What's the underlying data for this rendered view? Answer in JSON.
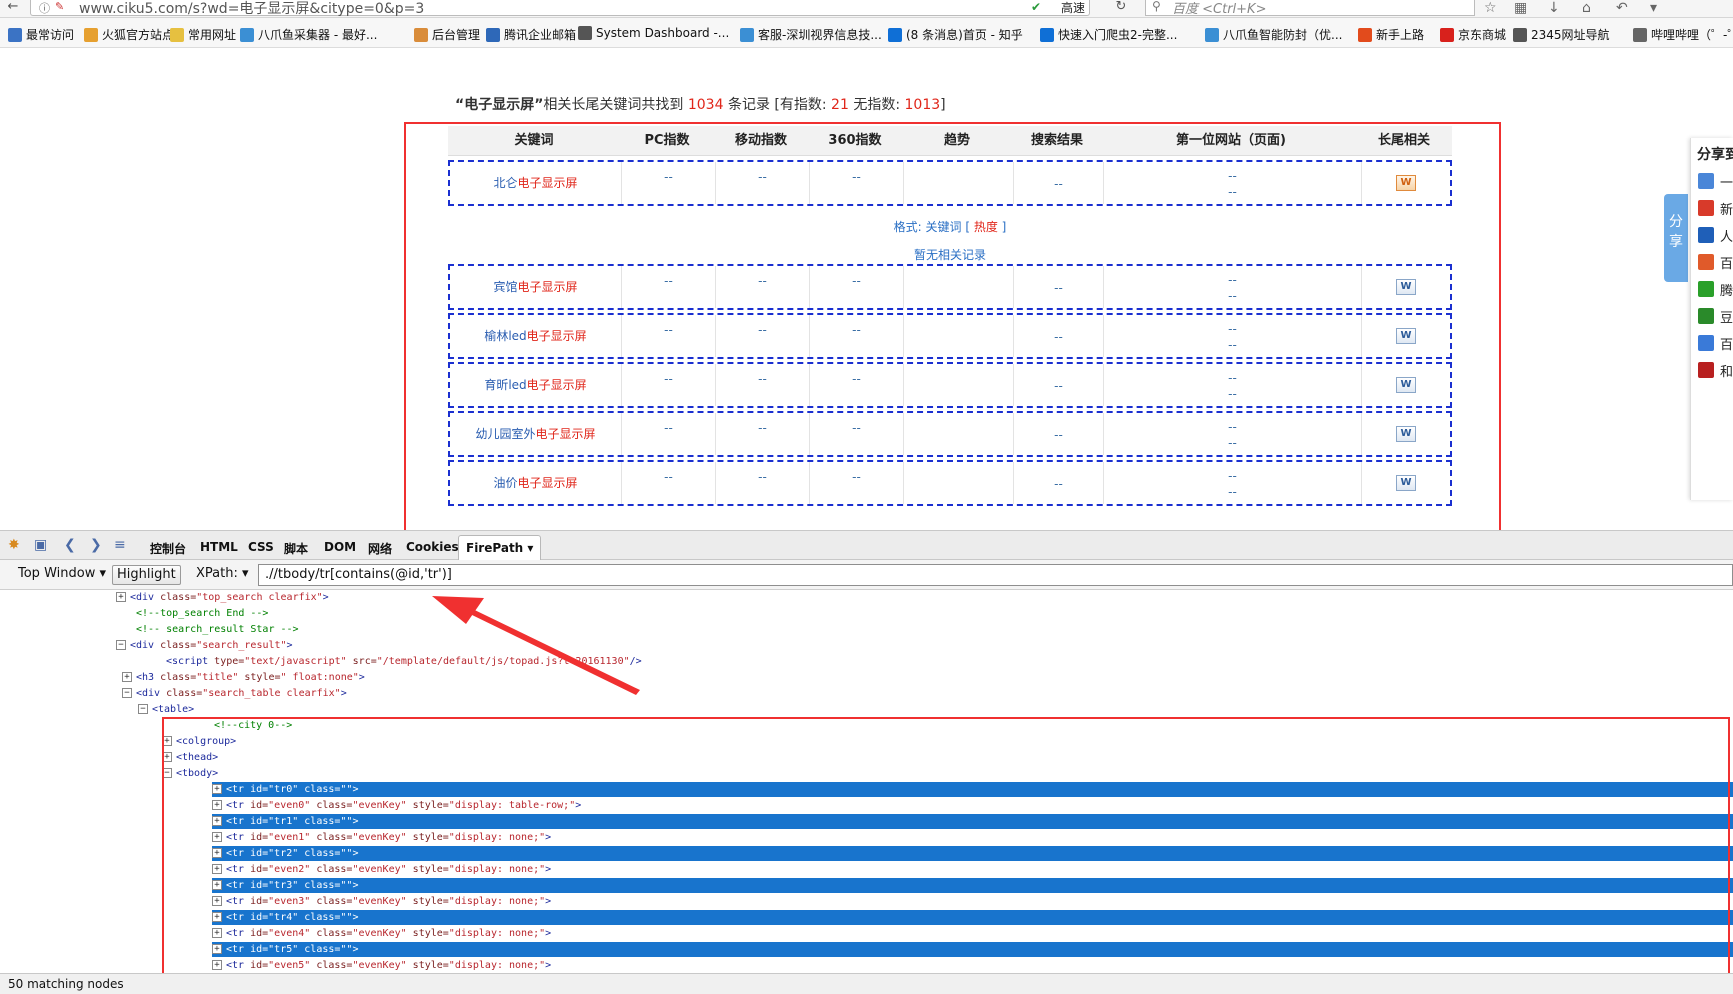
{
  "browser": {
    "url": "www.ciku5.com/s?wd=电子显示屏&citype=0&p=3",
    "search_placeholder": "百度 <Ctrl+K>",
    "speed_label": "高速",
    "bookmarks": [
      {
        "label": "最常访问",
        "icon_color": "#3b73c4"
      },
      {
        "label": "火狐官方站点",
        "icon_color": "#e6a030"
      },
      {
        "label": "常用网址",
        "icon_color": "#e6c040"
      },
      {
        "label": "八爪鱼采集器 - 最好...",
        "icon_color": "#3b8fd4"
      },
      {
        "label": "后台管理",
        "icon_color": "#d98c3a"
      },
      {
        "label": "腾讯企业邮箱",
        "icon_color": "#2e68b8"
      },
      {
        "label": "System Dashboard -...",
        "icon_color": "#555555"
      },
      {
        "label": "客服-深圳视界信息技...",
        "icon_color": "#3b8fd4"
      },
      {
        "label": "(8 条消息)首页 - 知乎",
        "icon_color": "#0f6fd6"
      },
      {
        "label": "快速入门爬虫2-完整...",
        "icon_color": "#0f6fd6"
      },
      {
        "label": "八爪鱼智能防封（优...",
        "icon_color": "#3b8fd4"
      },
      {
        "label": "新手上路",
        "icon_color": "#e24b1c"
      },
      {
        "label": "京东商城",
        "icon_color": "#d8211c"
      },
      {
        "label": "2345网址导航",
        "icon_color": "#555555"
      },
      {
        "label": "哔哩哔哩（゜-゜）",
        "icon_color": "#666666"
      }
    ]
  },
  "summary": {
    "keyword": "“电子显示屏”",
    "text1": "相关长尾关键词共找到",
    "total": "1034",
    "text2": "条记录 [有指数:",
    "with_index": "21",
    "text3": "无指数:",
    "no_index": "1013",
    "text4": "]"
  },
  "table": {
    "headers": [
      "关键词",
      "PC指数",
      "移动指数",
      "360指数",
      "趋势",
      "搜索结果",
      "第一位网站（页面)",
      "长尾相关"
    ],
    "first_row": {
      "prefix": "北仑",
      "highlight": "电子显示屏",
      "pc": "--",
      "mobile": "--",
      "s360": "--",
      "trend": "",
      "results": "--",
      "site1": "--",
      "site2": "--",
      "icon": "W"
    },
    "format_label": "格式:",
    "format_kw": "关键词",
    "format_hot": "热度",
    "no_related": "暂无相关记录",
    "rows": [
      {
        "prefix": "宾馆",
        "highlight": "电子显示屏",
        "pc": "--",
        "mobile": "--",
        "s360": "--",
        "results": "--",
        "site1": "--",
        "site2": "--",
        "icon": "W"
      },
      {
        "prefix": "榆林led",
        "highlight": "电子显示屏",
        "pc": "--",
        "mobile": "--",
        "s360": "--",
        "results": "--",
        "site1": "--",
        "site2": "--",
        "icon": "W"
      },
      {
        "prefix": "育昕led",
        "highlight": "电子显示屏",
        "pc": "--",
        "mobile": "--",
        "s360": "--",
        "results": "--",
        "site1": "--",
        "site2": "--",
        "icon": "W"
      },
      {
        "prefix": "幼儿园室外",
        "highlight": "电子显示屏",
        "pc": "--",
        "mobile": "--",
        "s360": "--",
        "results": "--",
        "site1": "--",
        "site2": "--",
        "icon": "W"
      },
      {
        "prefix": "油价",
        "highlight": "电子显示屏",
        "pc": "--",
        "mobile": "--",
        "s360": "--",
        "results": "--",
        "site1": "--",
        "site2": "--",
        "icon": "W"
      }
    ]
  },
  "share": {
    "tab_label": "分享",
    "title": "分享到",
    "items": [
      {
        "label": "一",
        "color": "#4a86d8"
      },
      {
        "label": "新",
        "color": "#d83a2a"
      },
      {
        "label": "人",
        "color": "#1f5fb8"
      },
      {
        "label": "百",
        "color": "#e05a2a"
      },
      {
        "label": "腾",
        "color": "#2aa02a"
      },
      {
        "label": "豆",
        "color": "#2a8a2a"
      },
      {
        "label": "百",
        "color": "#3a7ad8"
      },
      {
        "label": "和",
        "color": "#b82020"
      }
    ]
  },
  "devtools": {
    "tabs": [
      "控制台",
      "HTML",
      "CSS",
      "脚本",
      "DOM",
      "网络",
      "Cookies",
      "FirePath"
    ],
    "active_tab": "FirePath",
    "top_window": "Top Window",
    "highlight": "Highlight",
    "xpath_label": "XPath:",
    "xpath_value": ".//tbody/tr[contains(@id,'tr')]",
    "status": "50 matching nodes"
  },
  "html_tree": [
    {
      "indent": 0,
      "exp": "+",
      "parts": [
        [
          "tag",
          "<div "
        ],
        [
          "attr",
          "class="
        ],
        [
          "val",
          "\"top_search clearfix\""
        ],
        [
          "tag",
          ">"
        ]
      ]
    },
    {
      "indent": 1,
      "exp": "",
      "parts": [
        [
          "comment",
          "<!--top_search End -->"
        ]
      ]
    },
    {
      "indent": 1,
      "exp": "",
      "parts": [
        [
          "comment",
          "<!-- search_result Star -->"
        ]
      ]
    },
    {
      "indent": 0,
      "exp": "-",
      "parts": [
        [
          "tag",
          "<div "
        ],
        [
          "attr",
          "class="
        ],
        [
          "val",
          "\"search_result\""
        ],
        [
          "tag",
          ">"
        ]
      ]
    },
    {
      "indent": 2,
      "exp": "",
      "parts": [
        [
          "tag",
          "<script "
        ],
        [
          "attr",
          "type="
        ],
        [
          "val",
          "\"text/javascript\" "
        ],
        [
          "attr",
          "src="
        ],
        [
          "val",
          "\"/template/default/js/topad.js?t=20161130\""
        ],
        [
          "tag",
          "/>"
        ]
      ]
    },
    {
      "indent": 1,
      "exp": "+",
      "parts": [
        [
          "tag",
          "<h3 "
        ],
        [
          "attr",
          "class="
        ],
        [
          "val",
          "\"title\" "
        ],
        [
          "attr",
          "style="
        ],
        [
          "val",
          "\" float:none\""
        ],
        [
          "tag",
          ">"
        ]
      ]
    },
    {
      "indent": 1,
      "exp": "-",
      "parts": [
        [
          "tag",
          "<div "
        ],
        [
          "attr",
          "class="
        ],
        [
          "val",
          "\"search_table clearfix\""
        ],
        [
          "tag",
          ">"
        ]
      ]
    },
    {
      "indent": 2,
      "exp": "-",
      "parts": [
        [
          "tag",
          "<table>"
        ]
      ]
    },
    {
      "indent": 3,
      "exp": "",
      "parts": [
        [
          "comment",
          "<!--city 0-->"
        ]
      ]
    },
    {
      "indent": 3,
      "exp": "+",
      "parts": [
        [
          "tag",
          "<colgroup>"
        ]
      ]
    },
    {
      "indent": 3,
      "exp": "+",
      "parts": [
        [
          "tag",
          "<thead>"
        ]
      ]
    },
    {
      "indent": 3,
      "exp": "-",
      "parts": [
        [
          "tag",
          "<tbody>"
        ]
      ]
    },
    {
      "indent": 4,
      "exp": "+",
      "sel": true,
      "parts": [
        [
          "tag",
          "<tr "
        ],
        [
          "attr",
          "id="
        ],
        [
          "val",
          "\"tr0\" "
        ],
        [
          "attr",
          "class="
        ],
        [
          "val",
          "\"\""
        ],
        [
          "tag",
          ">"
        ]
      ]
    },
    {
      "indent": 4,
      "exp": "+",
      "parts": [
        [
          "tag",
          "<tr "
        ],
        [
          "attr",
          "id="
        ],
        [
          "val",
          "\"even0\" "
        ],
        [
          "attr",
          "class="
        ],
        [
          "val",
          "\"evenKey\" "
        ],
        [
          "attr",
          "style="
        ],
        [
          "val",
          "\"display: table-row;\""
        ],
        [
          "tag",
          ">"
        ]
      ]
    },
    {
      "indent": 4,
      "exp": "+",
      "sel": true,
      "parts": [
        [
          "tag",
          "<tr "
        ],
        [
          "attr",
          "id="
        ],
        [
          "val",
          "\"tr1\" "
        ],
        [
          "attr",
          "class="
        ],
        [
          "val",
          "\"\""
        ],
        [
          "tag",
          ">"
        ]
      ]
    },
    {
      "indent": 4,
      "exp": "+",
      "parts": [
        [
          "tag",
          "<tr "
        ],
        [
          "attr",
          "id="
        ],
        [
          "val",
          "\"even1\" "
        ],
        [
          "attr",
          "class="
        ],
        [
          "val",
          "\"evenKey\" "
        ],
        [
          "attr",
          "style="
        ],
        [
          "val",
          "\"display: none;\""
        ],
        [
          "tag",
          ">"
        ]
      ]
    },
    {
      "indent": 4,
      "exp": "+",
      "sel": true,
      "parts": [
        [
          "tag",
          "<tr "
        ],
        [
          "attr",
          "id="
        ],
        [
          "val",
          "\"tr2\" "
        ],
        [
          "attr",
          "class="
        ],
        [
          "val",
          "\"\""
        ],
        [
          "tag",
          ">"
        ]
      ]
    },
    {
      "indent": 4,
      "exp": "+",
      "parts": [
        [
          "tag",
          "<tr "
        ],
        [
          "attr",
          "id="
        ],
        [
          "val",
          "\"even2\" "
        ],
        [
          "attr",
          "class="
        ],
        [
          "val",
          "\"evenKey\" "
        ],
        [
          "attr",
          "style="
        ],
        [
          "val",
          "\"display: none;\""
        ],
        [
          "tag",
          ">"
        ]
      ]
    },
    {
      "indent": 4,
      "exp": "+",
      "sel": true,
      "parts": [
        [
          "tag",
          "<tr "
        ],
        [
          "attr",
          "id="
        ],
        [
          "val",
          "\"tr3\" "
        ],
        [
          "attr",
          "class="
        ],
        [
          "val",
          "\"\""
        ],
        [
          "tag",
          ">"
        ]
      ]
    },
    {
      "indent": 4,
      "exp": "+",
      "parts": [
        [
          "tag",
          "<tr "
        ],
        [
          "attr",
          "id="
        ],
        [
          "val",
          "\"even3\" "
        ],
        [
          "attr",
          "class="
        ],
        [
          "val",
          "\"evenKey\" "
        ],
        [
          "attr",
          "style="
        ],
        [
          "val",
          "\"display: none;\""
        ],
        [
          "tag",
          ">"
        ]
      ]
    },
    {
      "indent": 4,
      "exp": "+",
      "sel": true,
      "parts": [
        [
          "tag",
          "<tr "
        ],
        [
          "attr",
          "id="
        ],
        [
          "val",
          "\"tr4\" "
        ],
        [
          "attr",
          "class="
        ],
        [
          "val",
          "\"\""
        ],
        [
          "tag",
          ">"
        ]
      ]
    },
    {
      "indent": 4,
      "exp": "+",
      "parts": [
        [
          "tag",
          "<tr "
        ],
        [
          "attr",
          "id="
        ],
        [
          "val",
          "\"even4\" "
        ],
        [
          "attr",
          "class="
        ],
        [
          "val",
          "\"evenKey\" "
        ],
        [
          "attr",
          "style="
        ],
        [
          "val",
          "\"display: none;\""
        ],
        [
          "tag",
          ">"
        ]
      ]
    },
    {
      "indent": 4,
      "exp": "+",
      "sel": true,
      "parts": [
        [
          "tag",
          "<tr "
        ],
        [
          "attr",
          "id="
        ],
        [
          "val",
          "\"tr5\" "
        ],
        [
          "attr",
          "class="
        ],
        [
          "val",
          "\"\""
        ],
        [
          "tag",
          ">"
        ]
      ]
    },
    {
      "indent": 4,
      "exp": "+",
      "parts": [
        [
          "tag",
          "<tr "
        ],
        [
          "attr",
          "id="
        ],
        [
          "val",
          "\"even5\" "
        ],
        [
          "attr",
          "class="
        ],
        [
          "val",
          "\"evenKey\" "
        ],
        [
          "attr",
          "style="
        ],
        [
          "val",
          "\"display: none;\""
        ],
        [
          "tag",
          ">"
        ]
      ]
    }
  ],
  "colors": {
    "highlight_red": "#e0261a",
    "selection_blue": "#1874cd",
    "dashed_border": "#1a2fd0",
    "annotation_red": "#f03030"
  }
}
